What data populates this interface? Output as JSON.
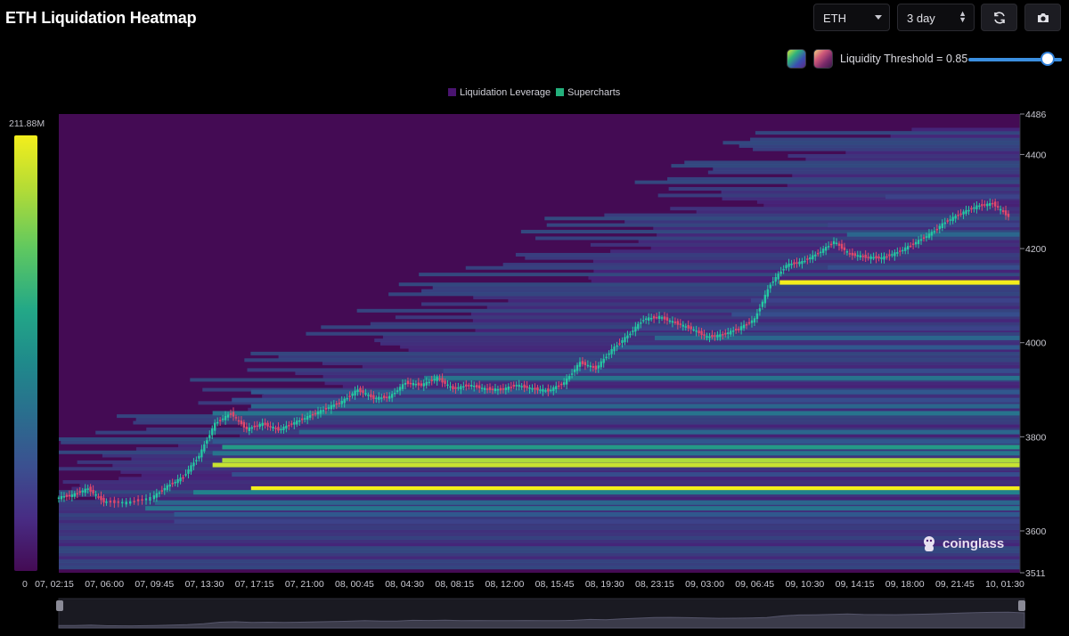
{
  "header": {
    "title": "ETH Liquidation Heatmap",
    "coin_select": "ETH",
    "range_select": "3 day",
    "threshold_label": "Liquidity Threshold = 0.85",
    "refresh_icon": "refresh-icon",
    "camera_icon": "camera-icon"
  },
  "threshold": {
    "value": 0.85,
    "min": 0,
    "max": 1
  },
  "watermark": "coinglass",
  "chart_data": {
    "type": "heatmap",
    "title": "ETH Liquidation Heatmap",
    "legend": [
      {
        "name": "Liquidation Leverage",
        "color": "#4a1470"
      },
      {
        "name": "Supercharts",
        "color": "#23b07c"
      }
    ],
    "legend_position": "top-center",
    "colorbar": {
      "max_label": "211.88M",
      "min_label": "0",
      "max": 211.88,
      "min": 0,
      "unit": "M"
    },
    "x_ticks": [
      "07, 02:15",
      "07, 06:00",
      "07, 09:45",
      "07, 13:30",
      "07, 17:15",
      "07, 21:00",
      "08, 00:45",
      "08, 04:30",
      "08, 08:15",
      "08, 12:00",
      "08, 15:45",
      "08, 19:30",
      "08, 23:15",
      "09, 03:00",
      "09, 06:45",
      "09, 10:30",
      "09, 14:15",
      "09, 18:00",
      "09, 21:45",
      "10, 01:30"
    ],
    "y_ticks": [
      4486,
      4400,
      4200,
      4000,
      3800,
      3600,
      3511
    ],
    "ylim": [
      3511,
      4486
    ],
    "grid": false,
    "price_path": [
      [
        0,
        3670
      ],
      [
        4,
        3676
      ],
      [
        8,
        3690
      ],
      [
        12,
        3662
      ],
      [
        18,
        3660
      ],
      [
        24,
        3670
      ],
      [
        28,
        3695
      ],
      [
        32,
        3715
      ],
      [
        36,
        3760
      ],
      [
        40,
        3828
      ],
      [
        44,
        3850
      ],
      [
        48,
        3816
      ],
      [
        52,
        3828
      ],
      [
        56,
        3815
      ],
      [
        60,
        3830
      ],
      [
        64,
        3845
      ],
      [
        68,
        3860
      ],
      [
        72,
        3875
      ],
      [
        76,
        3900
      ],
      [
        80,
        3882
      ],
      [
        84,
        3885
      ],
      [
        88,
        3915
      ],
      [
        92,
        3910
      ],
      [
        96,
        3925
      ],
      [
        100,
        3902
      ],
      [
        104,
        3910
      ],
      [
        108,
        3902
      ],
      [
        112,
        3900
      ],
      [
        116,
        3910
      ],
      [
        120,
        3902
      ],
      [
        124,
        3898
      ],
      [
        128,
        3915
      ],
      [
        132,
        3958
      ],
      [
        136,
        3945
      ],
      [
        140,
        3985
      ],
      [
        144,
        4015
      ],
      [
        148,
        4050
      ],
      [
        152,
        4055
      ],
      [
        156,
        4042
      ],
      [
        160,
        4030
      ],
      [
        164,
        4012
      ],
      [
        168,
        4017
      ],
      [
        172,
        4030
      ],
      [
        176,
        4050
      ],
      [
        180,
        4125
      ],
      [
        184,
        4165
      ],
      [
        188,
        4172
      ],
      [
        192,
        4190
      ],
      [
        196,
        4215
      ],
      [
        200,
        4188
      ],
      [
        204,
        4182
      ],
      [
        208,
        4180
      ],
      [
        212,
        4192
      ],
      [
        216,
        4210
      ],
      [
        220,
        4230
      ],
      [
        224,
        4256
      ],
      [
        228,
        4275
      ],
      [
        232,
        4290
      ],
      [
        236,
        4296
      ],
      [
        240,
        4268
      ]
    ],
    "price_x_span": 240,
    "liquidation_bands": [
      {
        "price": 3690,
        "start": 0.2,
        "intensity": 1.0
      },
      {
        "price": 3682,
        "start": 0.14,
        "intensity": 0.55
      },
      {
        "price": 3660,
        "start": 0.1,
        "intensity": 0.45
      },
      {
        "price": 3648,
        "start": 0.09,
        "intensity": 0.5
      },
      {
        "price": 3635,
        "start": 0.12,
        "intensity": 0.4
      },
      {
        "price": 3620,
        "start": 0.12,
        "intensity": 0.3
      },
      {
        "price": 3740,
        "start": 0.16,
        "intensity": 0.95
      },
      {
        "price": 3750,
        "start": 0.17,
        "intensity": 0.92
      },
      {
        "price": 3765,
        "start": 0.16,
        "intensity": 0.5
      },
      {
        "price": 3778,
        "start": 0.17,
        "intensity": 0.65
      },
      {
        "price": 3790,
        "start": 0.16,
        "intensity": 0.4
      },
      {
        "price": 3720,
        "start": 0.18,
        "intensity": 0.35
      },
      {
        "price": 3810,
        "start": 0.25,
        "intensity": 0.45
      },
      {
        "price": 3850,
        "start": 0.16,
        "intensity": 0.5
      },
      {
        "price": 3865,
        "start": 0.2,
        "intensity": 0.45
      },
      {
        "price": 3878,
        "start": 0.18,
        "intensity": 0.35
      },
      {
        "price": 3895,
        "start": 0.2,
        "intensity": 0.4
      },
      {
        "price": 3925,
        "start": 0.38,
        "intensity": 0.5
      },
      {
        "price": 3940,
        "start": 0.4,
        "intensity": 0.35
      },
      {
        "price": 3990,
        "start": 0.58,
        "intensity": 0.4
      },
      {
        "price": 4010,
        "start": 0.62,
        "intensity": 0.45
      },
      {
        "price": 4030,
        "start": 0.6,
        "intensity": 0.3
      },
      {
        "price": 4060,
        "start": 0.7,
        "intensity": 0.35
      },
      {
        "price": 4090,
        "start": 0.72,
        "intensity": 0.3
      },
      {
        "price": 4128,
        "start": 0.75,
        "intensity": 1.0
      },
      {
        "price": 4160,
        "start": 0.8,
        "intensity": 0.35
      },
      {
        "price": 4230,
        "start": 0.82,
        "intensity": 0.45
      },
      {
        "price": 4250,
        "start": 0.8,
        "intensity": 0.3
      },
      {
        "price": 4310,
        "start": 0.86,
        "intensity": 0.3
      }
    ]
  }
}
